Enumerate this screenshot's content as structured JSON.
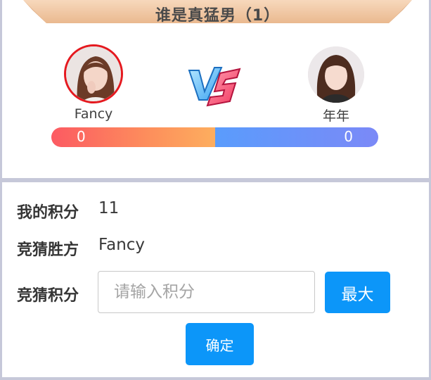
{
  "header": {
    "title": "谁是真猛男（1）"
  },
  "players": {
    "left": {
      "name": "Fancy",
      "score": "0",
      "avatar": "avatar-photo",
      "selected": true
    },
    "right": {
      "name": "年年",
      "score": "0",
      "avatar": "avatar-photo",
      "selected": false
    }
  },
  "vs_icon": "vs-icon",
  "score_split": {
    "left_fraction": 0.5,
    "right_fraction": 0.5
  },
  "colors": {
    "left_bar": "#fc5a62",
    "right_bar": "#5a9cfc",
    "primary_button": "#0c96f9",
    "banner": "#f0c7a3",
    "selected_ring": "#e5191f"
  },
  "form": {
    "my_points_label": "我的积分",
    "my_points_value": "11",
    "winner_label": "竞猜胜方",
    "winner_value": "Fancy",
    "bet_label": "竞猜积分",
    "bet_placeholder": "请输入积分",
    "max_label": "最大",
    "confirm_label": "确定"
  }
}
